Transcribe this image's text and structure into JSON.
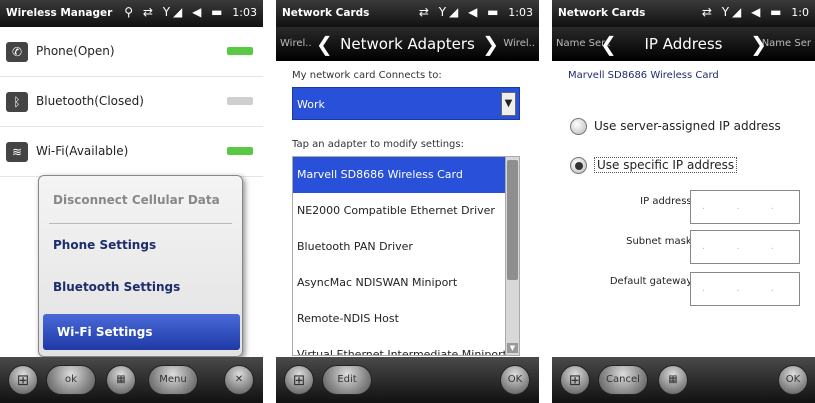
{
  "panel1": {
    "status": {
      "title": "Wireless Manager",
      "icons": "⚲ ⇄ Y◢ ◀ ▬",
      "time": "1:03"
    },
    "items": [
      {
        "label": "Phone(Open)",
        "icon": "phone-icon",
        "icon_glyph": "✆",
        "state": "on"
      },
      {
        "label": "Bluetooth(Closed)",
        "icon": "bluetooth-icon",
        "icon_glyph": "ᛒ",
        "state": "off"
      },
      {
        "label": "Wi-Fi(Available)",
        "icon": "wifi-icon",
        "icon_glyph": "≋",
        "state": "on"
      }
    ],
    "menu": {
      "items": [
        {
          "label": "Disconnect Cellular Data",
          "state": "disabled"
        },
        {
          "label": "Phone Settings",
          "state": "normal"
        },
        {
          "label": "Bluetooth Settings",
          "state": "normal"
        },
        {
          "label": "Wi-Fi Settings",
          "state": "selected"
        }
      ]
    },
    "softkeys": {
      "left": "ok",
      "right": "Menu",
      "start_glyph": "⊞",
      "kbd_glyph": "▦",
      "close_glyph": "✕"
    }
  },
  "panel2": {
    "status": {
      "title": "Network Cards",
      "icons": "⇄ Y◢ ◀ ▬",
      "time": "1:03"
    },
    "nav": {
      "left": "Wirel..",
      "center": "Network Adapters",
      "right": "Wirel.."
    },
    "connects_label": "My network card Connects to:",
    "connects_value": "Work",
    "tap_label": "Tap an adapter to modify settings:",
    "adapters": [
      "Marvell SD8686 Wireless Card",
      "NE2000 Compatible Ethernet Driver",
      "Bluetooth PAN Driver",
      "AsyncMac NDISWAN Miniport",
      "Remote-NDIS Host",
      "Virtual Ethernet Intermediate Miniport"
    ],
    "selected_adapter": 0,
    "softkeys": {
      "left": "Edit",
      "right": "OK",
      "start_glyph": "⊞"
    }
  },
  "panel3": {
    "status": {
      "title": "Network Cards",
      "icons": "⇄ Y◢ ◀ ▬",
      "time": "1:0"
    },
    "nav": {
      "left": "Name Ser..",
      "center": "IP Address",
      "right": "Name Ser"
    },
    "card_title": "Marvell SD8686 Wireless Card",
    "radio_server": "Use server-assigned IP address",
    "radio_specific": "Use specific IP address",
    "selected_radio": "specific",
    "fields": [
      {
        "label": "IP address:",
        "value": ". . ."
      },
      {
        "label": "Subnet mask:",
        "value": ". . ."
      },
      {
        "label": "Default gateway:",
        "value": ". . ."
      }
    ],
    "softkeys": {
      "left": "Cancel",
      "right": "OK",
      "start_glyph": "⊞",
      "kbd_glyph": "▦"
    }
  },
  "colors": {
    "accent": "#2850d8",
    "toggle_on": "#59c842",
    "menu_text": "#1c2c6c"
  }
}
